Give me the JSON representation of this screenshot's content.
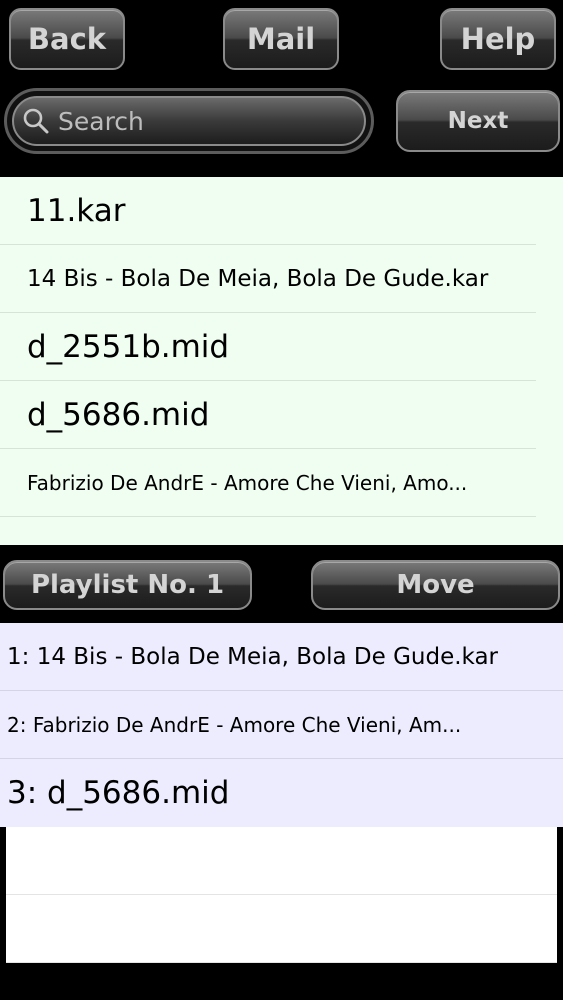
{
  "toolbar": {
    "back_label": "Back",
    "mail_label": "Mail",
    "help_label": "Help"
  },
  "search": {
    "placeholder": "Search",
    "value": "",
    "icon": "search-icon",
    "next_label": "Next"
  },
  "files": [
    {
      "name": "11.kar"
    },
    {
      "name": "14 Bis - Bola De Meia, Bola De Gude.kar"
    },
    {
      "name": "d_2551b.mid"
    },
    {
      "name": "d_5686.mid"
    },
    {
      "name": "Fabrizio De AndrE - Amore Che Vieni, Amo..."
    }
  ],
  "playlist_bar": {
    "playlist_label": "Playlist No. 1",
    "move_label": "Move"
  },
  "playlist": [
    {
      "label": "1: 14 Bis - Bola De Meia, Bola De Gude.kar"
    },
    {
      "label": "2: Fabrizio De AndrE - Amore Che Vieni, Am..."
    },
    {
      "label": "3: d_5686.mid"
    }
  ],
  "colors": {
    "file_list_bg": "#effef0",
    "playlist_bg": "#ececfe",
    "toolbar_bg": "#000000"
  }
}
